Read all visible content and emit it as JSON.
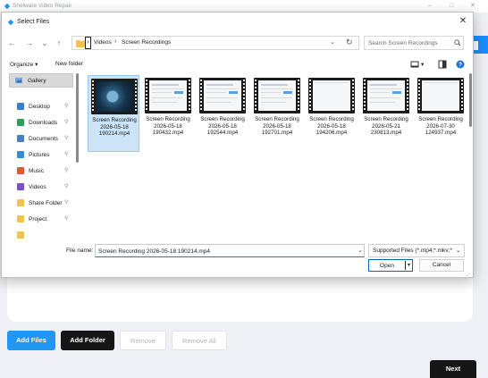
{
  "app": {
    "title": "Shelware Video Repair",
    "buttons": {
      "add_files": "Add Files",
      "add_folder": "Add Folder",
      "remove": "Remove",
      "remove_all": "Remove All",
      "next": "Next"
    },
    "accent": "#2196f3"
  },
  "dialog": {
    "title": "Select Files",
    "close_glyph": "✕",
    "nav": {
      "back": "←",
      "forward": "→",
      "recent": "⌄",
      "up": "↑"
    },
    "address": {
      "separator": "›",
      "crumbs": [
        "Videos",
        "Screen Recordings"
      ],
      "dropdown": "⌄",
      "refresh": "↻"
    },
    "search": {
      "placeholder": "Search Screen Recordings"
    },
    "toolbar": {
      "organize": "Organize ▾",
      "new_folder": "New folder",
      "view": "▾"
    },
    "sidebar": {
      "gallery": "Gallery",
      "items": [
        {
          "label": "Desktop",
          "icon": "desktop-icon",
          "color": "#3a7bd5",
          "pinned": true
        },
        {
          "label": "Downloads",
          "icon": "download-icon",
          "color": "#2e9e5b",
          "pinned": true
        },
        {
          "label": "Documents",
          "icon": "documents-icon",
          "color": "#4a7fc1",
          "pinned": true
        },
        {
          "label": "Pictures",
          "icon": "pictures-icon",
          "color": "#2f8fd8",
          "pinned": true
        },
        {
          "label": "Music",
          "icon": "music-icon",
          "color": "#e0583c",
          "pinned": true
        },
        {
          "label": "Videos",
          "icon": "videos-icon",
          "color": "#7b4fc9",
          "pinned": true
        },
        {
          "label": "Share Folder",
          "icon": "folder-icon",
          "color": "#f2c14e",
          "pinned": true
        },
        {
          "label": "Project",
          "icon": "folder-icon",
          "color": "#f2c14e",
          "pinned": true
        },
        {
          "label": "",
          "icon": "folder-icon",
          "color": "#f2c14e",
          "pinned": false
        }
      ],
      "pin_glyph": "⚲"
    },
    "files": [
      {
        "name": "Screen Recording\n2026-05-18\n190214.mp4",
        "selected": true,
        "style": "dark"
      },
      {
        "name": "Screen Recording\n2026-05-18\n190432.mp4",
        "selected": false,
        "style": "light"
      },
      {
        "name": "Screen Recording\n2026-05-18\n192544.mp4",
        "selected": false,
        "style": "light"
      },
      {
        "name": "Screen Recording\n2026-05-18\n192701.mp4",
        "selected": false,
        "style": "light"
      },
      {
        "name": "Screen Recording\n2026-05-18\n194206.mp4",
        "selected": false,
        "style": "blank"
      },
      {
        "name": "Screen Recording\n2026-05-21\n230813.mp4",
        "selected": false,
        "style": "light"
      },
      {
        "name": "Screen Recording\n2026-07-30\n124937.mp4",
        "selected": false,
        "style": "blank"
      }
    ],
    "footer": {
      "file_name_label": "File name:",
      "file_name_value": "Screen Recording 2026-05-18 190214.mp4",
      "file_type": "Supported Files (*.mp4;*.mkv;*",
      "open": "Open",
      "cancel": "Cancel",
      "split_glyph": "▾",
      "dropdown": "⌄"
    }
  }
}
